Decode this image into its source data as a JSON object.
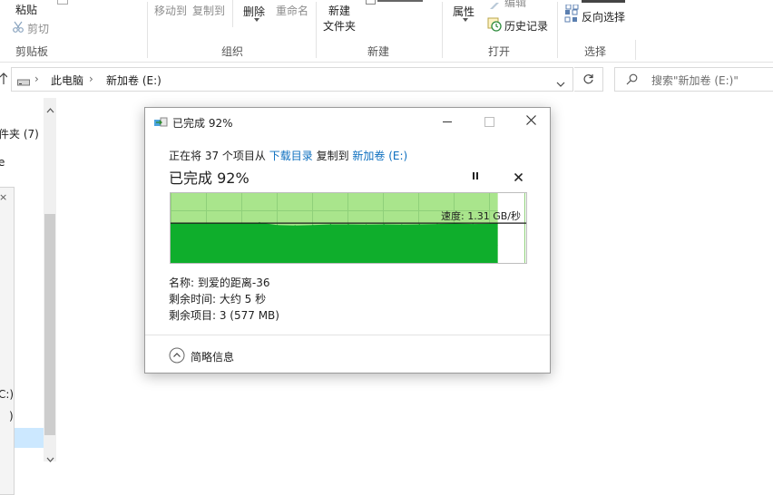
{
  "ribbon": {
    "paste_label": "粘贴",
    "cut_label": "剪切",
    "move_to_label": "移动到",
    "copy_to_label": "复制到",
    "delete_label": "删除",
    "rename_label": "重命名",
    "new_label": "新建",
    "new_folder_label": "文件夹",
    "properties_label": "属性",
    "edit_label": "编辑",
    "history_label": "历史记录",
    "invert_selection_label": "反向选择",
    "groups": {
      "clipboard": "剪贴板",
      "organize": "组织",
      "new": "新建",
      "open": "打开",
      "select": "选择"
    }
  },
  "address": {
    "segments": [
      "此电脑",
      "新加卷 (E:)"
    ],
    "search_placeholder": "搜索\"新加卷 (E:)\""
  },
  "nav": {
    "items": [
      "件夹 (7)",
      "e",
      "C:)",
      ")"
    ]
  },
  "dialog": {
    "title": "已完成 92%",
    "status_prefix": "正在将 37 个项目从",
    "source": "下载目录",
    "status_middle": "复制到",
    "destination": "新加卷 (E:)",
    "percent_text": "已完成 92%",
    "progress": 0.92,
    "speed_text": "速度: 1.31 GB/秒",
    "name_row": "名称: 到爱的距离-36",
    "time_row": "剩余时间: 大约 5 秒",
    "items_row": "剩余项目: 3 (577 MB)",
    "fewer_details": "简略信息",
    "colors": {
      "done": "#a9e58c",
      "fill": "#0fae2c",
      "border": "#bdbdbd"
    }
  },
  "chart_data": {
    "type": "area",
    "title": "",
    "xlabel": "",
    "ylabel": "",
    "x": [
      0,
      0.05,
      0.1,
      0.15,
      0.2,
      0.25,
      0.3,
      0.35,
      0.4,
      0.45,
      0.5,
      0.55,
      0.6,
      0.65,
      0.7,
      0.75,
      0.8,
      0.85,
      0.9,
      0.92
    ],
    "series": [
      {
        "values": [
          1.31,
          1.31,
          1.3,
          1.31,
          1.31,
          1.33,
          1.25,
          1.23,
          1.25,
          1.27,
          1.27,
          1.26,
          1.27,
          1.26,
          1.27,
          1.28,
          1.3,
          1.28,
          1.29,
          1.31
        ]
      }
    ],
    "xlim": [
      0,
      1
    ],
    "ylim": [
      0,
      2.3
    ],
    "current_speed": 1.31,
    "grid": true,
    "legend": "none"
  }
}
